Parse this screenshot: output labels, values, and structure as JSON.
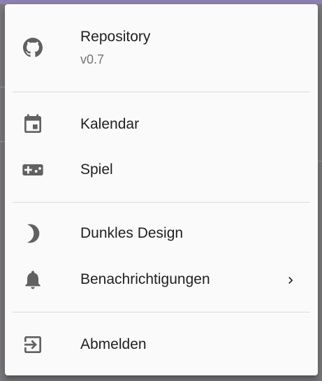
{
  "menu": {
    "repository": {
      "label": "Repository",
      "version": "v0.7",
      "icon": "github-icon"
    },
    "items": [
      {
        "label": "Kalendar",
        "icon": "calendar-icon"
      },
      {
        "label": "Spiel",
        "icon": "gamepad-icon"
      },
      {
        "label": "Dunkles Design",
        "icon": "moon-icon"
      },
      {
        "label": "Benachrichtigungen",
        "icon": "bell-icon",
        "submenu": true
      },
      {
        "label": "Abmelden",
        "icon": "logout-icon"
      }
    ]
  },
  "colors": {
    "menu_background": "#fafafa",
    "icon": "#616161",
    "text": "#212121",
    "secondary_text": "#757575",
    "backdrop_accent": "#8e82b4"
  }
}
